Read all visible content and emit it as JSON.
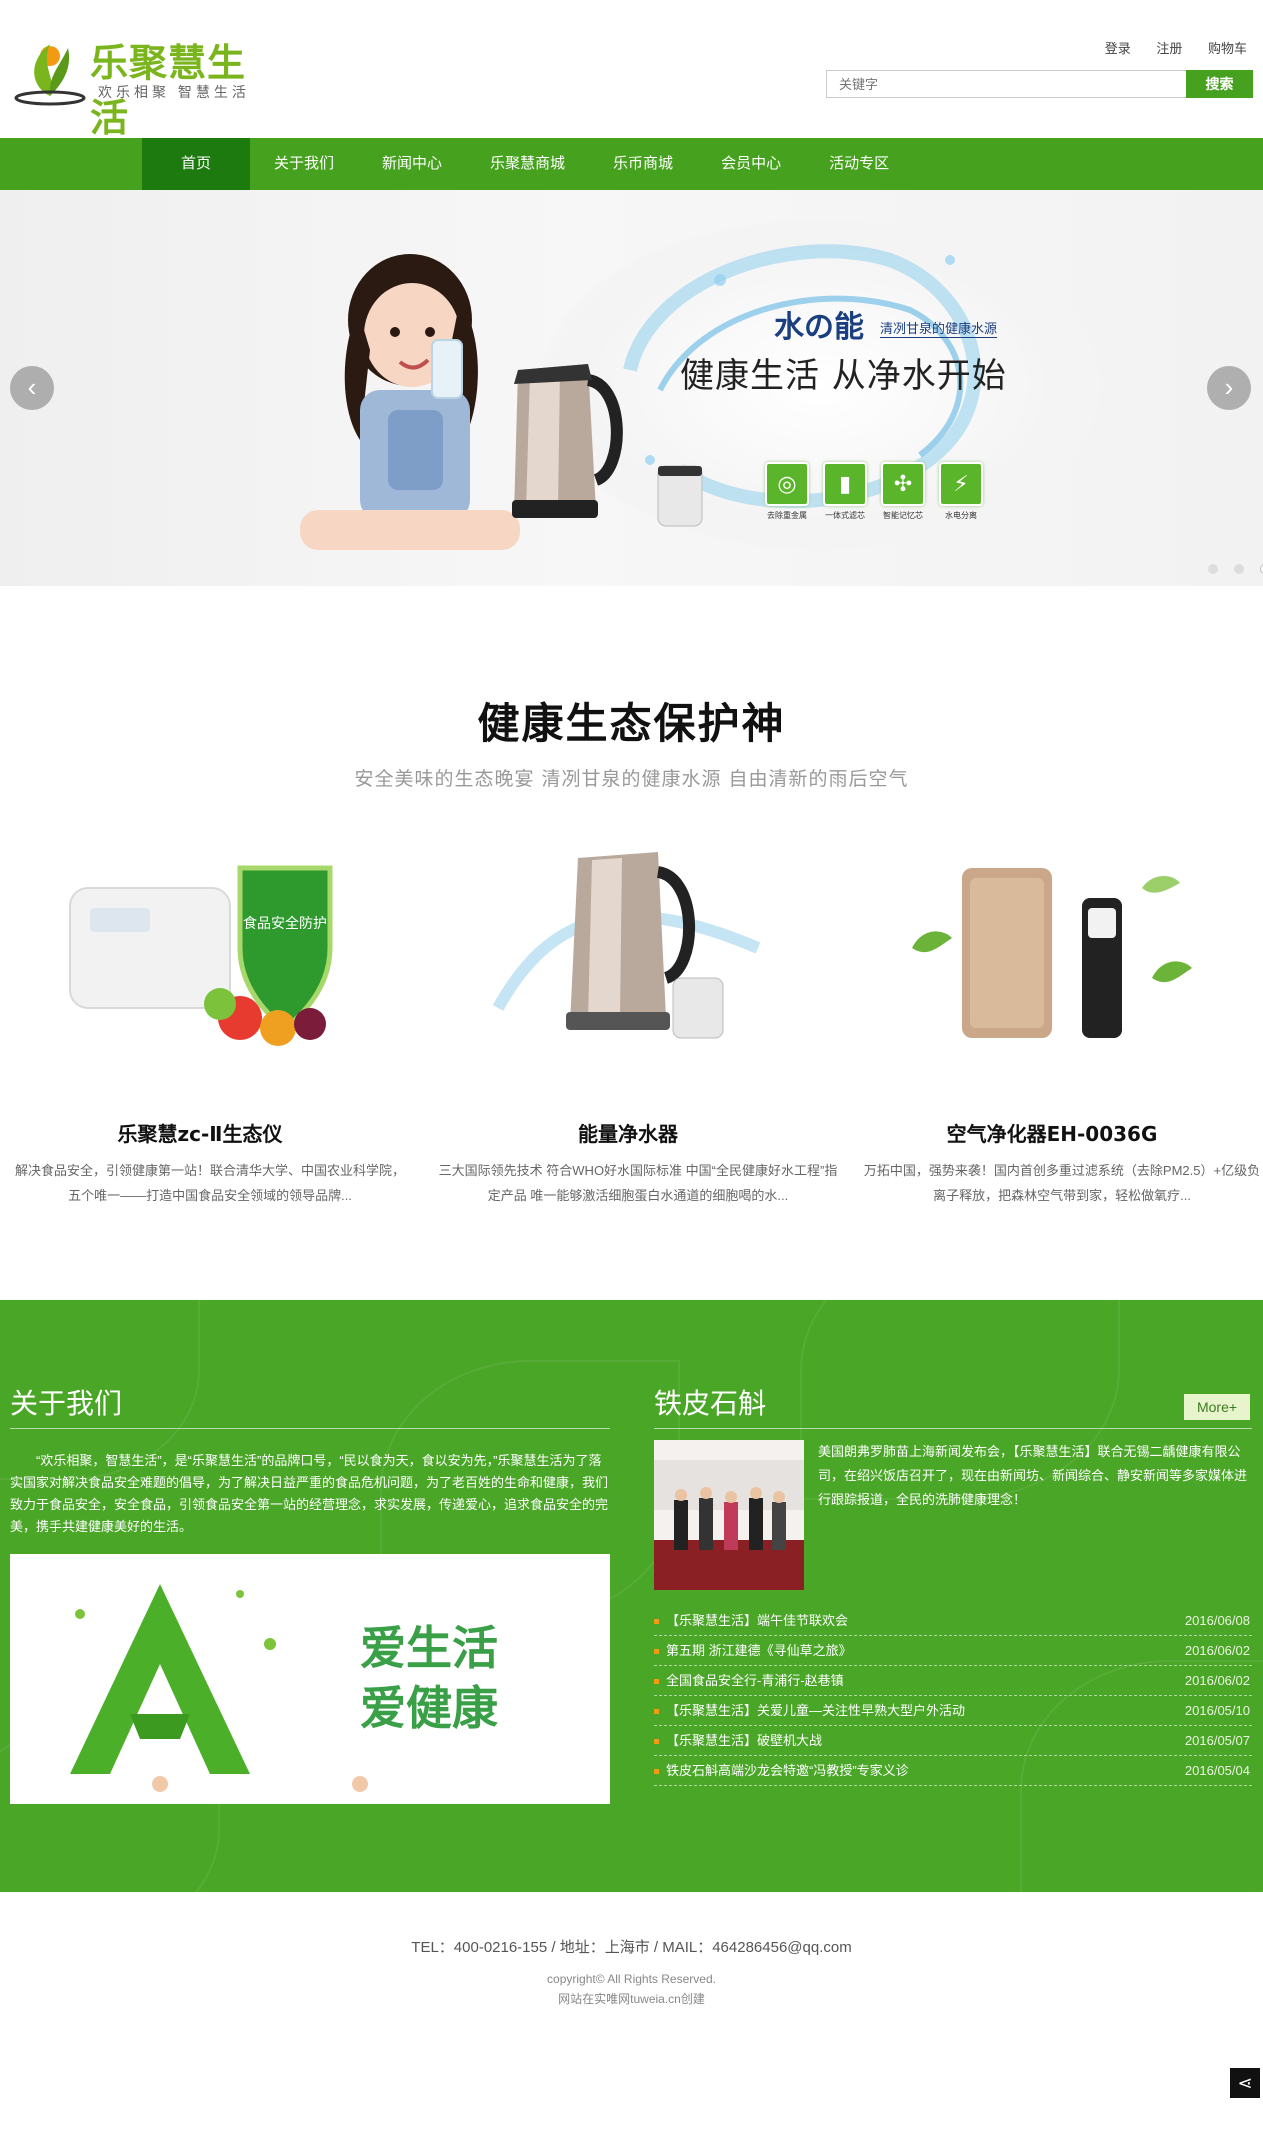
{
  "header": {
    "logo_text": "乐聚慧生活",
    "logo_slogan": "欢乐相聚  智慧生活",
    "links": [
      "登录",
      "注册",
      "购物车"
    ],
    "search_placeholder": "关键字",
    "search_button": "搜索"
  },
  "nav": {
    "items": [
      "首页",
      "关于我们",
      "新闻中心",
      "乐聚慧商城",
      "乐币商城",
      "会员中心",
      "活动专区"
    ],
    "active_index": 0
  },
  "banner": {
    "title_main": "水の能",
    "title_sub": "清冽甘泉的健康水源",
    "slogan": "健康生活 从净水开始",
    "features": [
      "去除重金属",
      "一体式滤芯",
      "智能记忆芯",
      "水电分离"
    ],
    "arrow_left": "‹",
    "arrow_right": "›",
    "slide_count": 3,
    "active_slide": 2
  },
  "products_section": {
    "title": "健康生态保护神",
    "subtitle": "安全美味的生态晚宴  清冽甘泉的健康水源  自由清新的雨后空气",
    "items": [
      {
        "name": "乐聚慧zc-Ⅱ生态仪",
        "desc": "解决食品安全，引领健康第一站！联合清华大学、中国农业科学院，五个唯一——打造中国食品安全领域的领导品牌..."
      },
      {
        "name": "能量净水器",
        "desc": "三大国际领先技术 符合WHO好水国际标准    中国“全民健康好水工程”指定产品    唯一能够激活细胞蛋白水通道的细胞喝的水..."
      },
      {
        "name": "空气净化器EH-0036G",
        "desc": "万拓中国，强势来袭！国内首创多重过滤系统（去除PM2.5）+亿级负离子释放，把森林空气带到家，轻松做氧疗..."
      }
    ]
  },
  "about": {
    "title": "关于我们",
    "text": "“欢乐相聚，智慧生活”，是“乐聚慧生活”的品牌口号，“民以食为天，食以安为先，”乐聚慧生活为了落实国家对解决食品安全难题的倡导，为了解决日益严重的食品危机问题，为了老百姓的生命和健康，我们致力于食品安全，安全食品，引领食品安全第一站的经营理念，求实发展，传递爱心，追求食品安全的完美，携手共建健康美好的生活。",
    "image_text_1": "爱生活",
    "image_text_2": "爱健康"
  },
  "news": {
    "title": "铁皮石斛",
    "more": "More+",
    "summary": "美国朗弗罗肺苗上海新闻发布会，【乐聚慧生活】联合无锡二龋健康有限公司，在绍兴饭店召开了，现在由新闻坊、新闻综合、静安新闻等多家媒体进行跟踪报道，全民的洗肺健康理念！",
    "items": [
      {
        "title": "【乐聚慧生活】端午佳节联欢会",
        "date": "2016/06/08"
      },
      {
        "title": "第五期 浙江建德《寻仙草之旅》",
        "date": "2016/06/02"
      },
      {
        "title": "全国食品安全行-青浦行-赵巷镇",
        "date": "2016/06/02"
      },
      {
        "title": "【乐聚慧生活】关爱儿童—关注性早熟大型户外活动",
        "date": "2016/05/10"
      },
      {
        "title": "【乐聚慧生活】破壁机大战",
        "date": "2016/05/07"
      },
      {
        "title": "铁皮石斛高端沙龙会特邀“冯教授”专家义诊",
        "date": "2016/05/04"
      }
    ]
  },
  "footer": {
    "contact": "TEL：400-0216-155   /   地址：上海市   /   MAIL：464286456@qq.com",
    "copyright": "copyright© All Rights Reserved.",
    "built_by": "网站在实唯网tuweia.cn创建"
  },
  "colors": {
    "brand_green": "#46a21e",
    "nav_active": "#1d7a0f",
    "section_green": "#4aa627",
    "accent_orange": "#f29a12"
  }
}
